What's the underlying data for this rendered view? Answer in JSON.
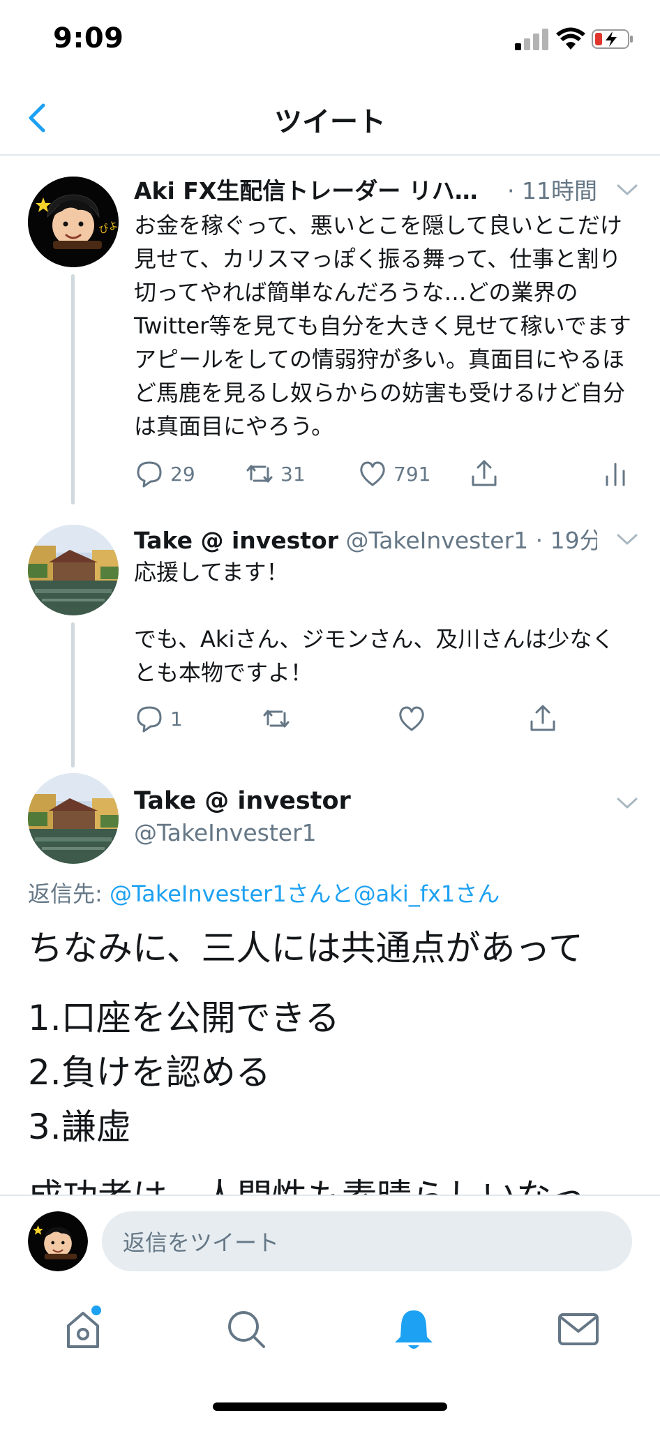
{
  "status_bar": {
    "time": "9:09"
  },
  "header": {
    "title": "ツイート"
  },
  "tweets": [
    {
      "name": "Aki FX生配信トレーダー リハ…",
      "handle": "",
      "time": "· 11時間",
      "text": "お金を稼ぐって、悪いとこを隠して良いとこだけ見せて、カリスマっぽく振る舞って、仕事と割り切ってやれば簡単なんだろうな…どの業界のTwitter等を見ても自分を大きく見せて稼いでますアピールをしての情弱狩が多い。真面目にやるほど馬鹿を見るし奴らからの妨害も受けるけど自分は真面目にやろう。",
      "replies": "29",
      "retweets": "31",
      "likes": "791"
    },
    {
      "name": "Take @ investor",
      "handle": "@TakeInvester1",
      "time": "· 19分",
      "text": "応援してます！\n\nでも、Akiさん、ジモンさん、及川さんは少なくとも本物ですよ！",
      "replies": "1"
    }
  ],
  "detail": {
    "name": "Take @ investor",
    "handle": "@TakeInvester1",
    "reply_to_label": "返信先: ",
    "reply_to_mentions": "@TakeInvester1さんと@aki_fx1さん",
    "paragraphs": [
      "ちなみに、三人には共通点があって",
      "1.口座を公開できる\n2.負けを認める\n3.謙虚",
      "成功者は、人間性も素晴らしいなっ"
    ]
  },
  "reply_bar": {
    "placeholder": "返信をツイート"
  },
  "tab_bar": {
    "items": [
      "home",
      "search",
      "notifications",
      "messages"
    ]
  },
  "colors": {
    "accent": "#1da1f2",
    "text_secondary": "#657786",
    "divider": "#e1e8ed",
    "input_bg": "#e6ecf0"
  },
  "icons": {
    "back": "chevron-left-icon",
    "reply": "speech-bubble-icon",
    "retweet": "retweet-icon",
    "like": "heart-icon",
    "share": "share-icon",
    "analytics": "bar-chart-icon",
    "caret": "chevron-down-icon"
  }
}
